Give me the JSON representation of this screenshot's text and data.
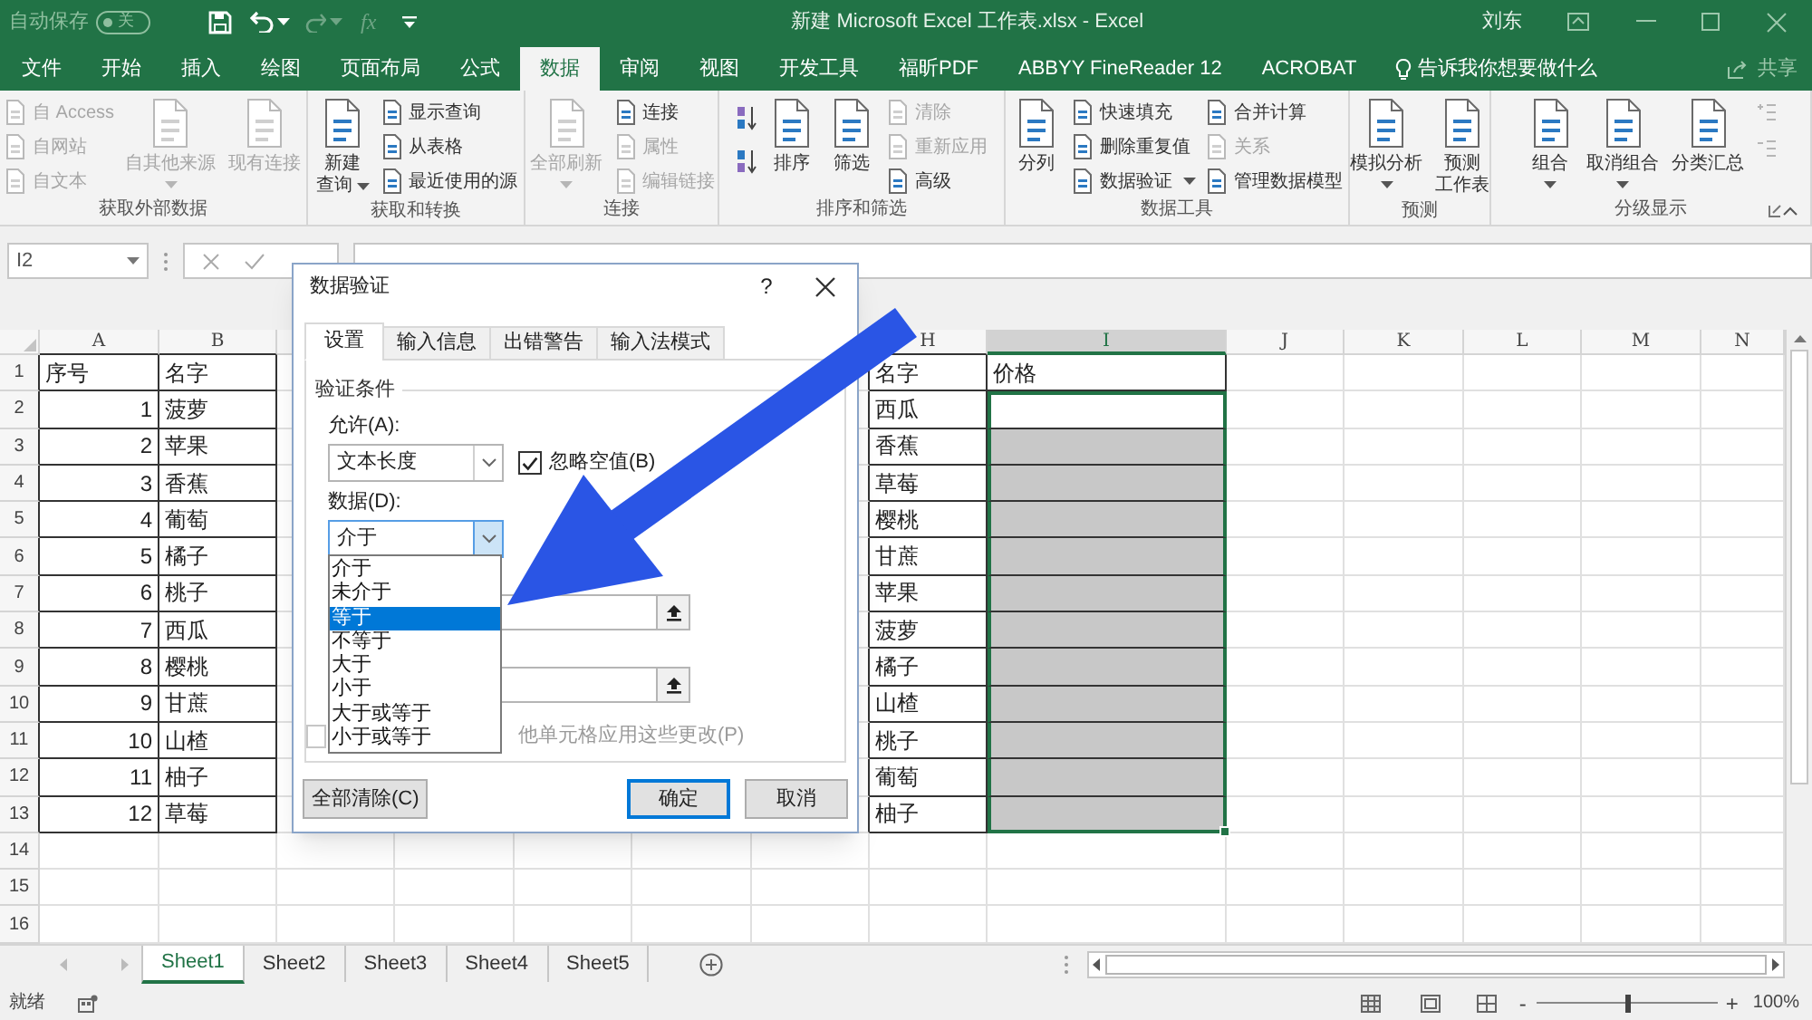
{
  "title_bar": {
    "autosave_label": "自动保存",
    "autosave_on": false,
    "autosave_state": "关",
    "function_symbol": "fx",
    "title": "新建 Microsoft Excel 工作表.xlsx - Excel",
    "user": "刘东"
  },
  "ribbon_tabs": [
    {
      "label": "文件",
      "selected": false
    },
    {
      "label": "开始",
      "selected": false
    },
    {
      "label": "插入",
      "selected": false
    },
    {
      "label": "绘图",
      "selected": false
    },
    {
      "label": "页面布局",
      "selected": false
    },
    {
      "label": "公式",
      "selected": false
    },
    {
      "label": "数据",
      "selected": true
    },
    {
      "label": "审阅",
      "selected": false
    },
    {
      "label": "视图",
      "selected": false
    },
    {
      "label": "开发工具",
      "selected": false
    },
    {
      "label": "福昕PDF",
      "selected": false
    },
    {
      "label": "ABBYY FineReader 12",
      "selected": false
    },
    {
      "label": "ACROBAT",
      "selected": false
    }
  ],
  "tell_me": "告诉我你想要做什么",
  "share": "共享",
  "ribbon": {
    "groups": [
      {
        "label": "获取外部数据",
        "launcher": false,
        "columns": [
          {
            "kind": "stack",
            "items": [
              {
                "label": "自 Access",
                "disabled": true,
                "menu": false
              },
              {
                "label": "自网站",
                "disabled": true,
                "menu": false
              },
              {
                "label": "自文本",
                "disabled": true,
                "menu": false
              }
            ]
          },
          {
            "kind": "large",
            "lines": [
              "自其他来源"
            ],
            "disabled": true,
            "menu": true
          },
          {
            "kind": "large",
            "lines": [
              "现有连接"
            ],
            "disabled": true,
            "menu": false
          }
        ]
      },
      {
        "label": "获取和转换",
        "launcher": false,
        "columns": [
          {
            "kind": "large",
            "lines": [
              "新建",
              "查询"
            ],
            "disabled": false,
            "menu": true
          },
          {
            "kind": "stack",
            "items": [
              {
                "label": "显示查询",
                "disabled": false,
                "menu": false
              },
              {
                "label": "从表格",
                "disabled": false,
                "menu": false
              },
              {
                "label": "最近使用的源",
                "disabled": false,
                "menu": false
              }
            ]
          }
        ]
      },
      {
        "label": "连接",
        "launcher": false,
        "columns": [
          {
            "kind": "large",
            "lines": [
              "全部刷新"
            ],
            "disabled": true,
            "menu": true
          },
          {
            "kind": "stack",
            "items": [
              {
                "label": "连接",
                "disabled": false,
                "menu": false
              },
              {
                "label": "属性",
                "disabled": true,
                "menu": false
              },
              {
                "label": "编辑链接",
                "disabled": true,
                "menu": false
              }
            ]
          }
        ]
      },
      {
        "label": "排序和筛选",
        "launcher": false,
        "columns": [
          {
            "kind": "sort"
          },
          {
            "kind": "large",
            "lines": [
              "排序"
            ],
            "disabled": false,
            "menu": false
          },
          {
            "kind": "large",
            "lines": [
              "筛选"
            ],
            "disabled": false,
            "menu": false
          },
          {
            "kind": "stack",
            "items": [
              {
                "label": "清除",
                "disabled": true,
                "menu": false
              },
              {
                "label": "重新应用",
                "disabled": true,
                "menu": false
              },
              {
                "label": "高级",
                "disabled": false,
                "menu": false
              }
            ]
          }
        ]
      },
      {
        "label": "数据工具",
        "launcher": false,
        "columns": [
          {
            "kind": "large",
            "lines": [
              "分列"
            ],
            "disabled": false,
            "menu": false
          },
          {
            "kind": "stack",
            "items": [
              {
                "label": "快速填充",
                "disabled": false,
                "menu": false
              },
              {
                "label": "删除重复值",
                "disabled": false,
                "menu": false
              },
              {
                "label": "数据验证",
                "disabled": false,
                "menu": true
              }
            ]
          },
          {
            "kind": "stack",
            "items": [
              {
                "label": "合并计算",
                "disabled": false,
                "menu": false
              },
              {
                "label": "关系",
                "disabled": true,
                "menu": false
              },
              {
                "label": "管理数据模型",
                "disabled": false,
                "menu": false
              }
            ]
          }
        ]
      },
      {
        "label": "预测",
        "launcher": false,
        "columns": [
          {
            "kind": "large",
            "lines": [
              "模拟分析"
            ],
            "disabled": false,
            "menu": true
          },
          {
            "kind": "large",
            "lines": [
              "预测",
              "工作表"
            ],
            "disabled": false,
            "menu": false
          }
        ]
      },
      {
        "label": "分级显示",
        "launcher": true,
        "columns": [
          {
            "kind": "large",
            "lines": [
              "组合"
            ],
            "disabled": false,
            "menu": true
          },
          {
            "kind": "large",
            "lines": [
              "取消组合"
            ],
            "disabled": false,
            "menu": true
          },
          {
            "kind": "large",
            "lines": [
              "分类汇总"
            ],
            "disabled": false,
            "menu": false
          },
          {
            "kind": "outline"
          }
        ]
      }
    ]
  },
  "sheet": {
    "name_box": "I2",
    "columns": [
      {
        "letter": "A",
        "selected": false
      },
      {
        "letter": "B",
        "selected": false
      },
      {
        "letter": "H",
        "selected": false
      },
      {
        "letter": "I",
        "selected": true
      },
      {
        "letter": "J",
        "selected": false
      },
      {
        "letter": "K",
        "selected": false
      },
      {
        "letter": "L",
        "selected": false
      },
      {
        "letter": "M",
        "selected": false
      },
      {
        "letter": "N",
        "selected": false
      }
    ],
    "rows": [
      {
        "number": "1",
        "A": "序号",
        "B": "名字",
        "H": "名字",
        "I": "价格",
        "I_shaded": false,
        "I_selected": false
      },
      {
        "number": "2",
        "A": "1",
        "B": "菠萝",
        "H": "西瓜",
        "I_shaded": false,
        "I_selected": true
      },
      {
        "number": "3",
        "A": "2",
        "B": "苹果",
        "H": "香蕉",
        "I_shaded": true,
        "I_selected": true
      },
      {
        "number": "4",
        "A": "3",
        "B": "香蕉",
        "H": "草莓",
        "I_shaded": true,
        "I_selected": true
      },
      {
        "number": "5",
        "A": "4",
        "B": "葡萄",
        "H": "樱桃",
        "I_shaded": true,
        "I_selected": true
      },
      {
        "number": "6",
        "A": "5",
        "B": "橘子",
        "H": "甘蔗",
        "I_shaded": true,
        "I_selected": true
      },
      {
        "number": "7",
        "A": "6",
        "B": "桃子",
        "H": "苹果",
        "I_shaded": true,
        "I_selected": true
      },
      {
        "number": "8",
        "A": "7",
        "B": "西瓜",
        "H": "菠萝",
        "I_shaded": true,
        "I_selected": true
      },
      {
        "number": "9",
        "A": "8",
        "B": "樱桃",
        "H": "橘子",
        "I_shaded": true,
        "I_selected": true
      },
      {
        "number": "10",
        "A": "9",
        "B": "甘蔗",
        "H": "山楂",
        "I_shaded": true,
        "I_selected": true
      },
      {
        "number": "11",
        "A": "10",
        "B": "山楂",
        "H": "桃子",
        "I_shaded": true,
        "I_selected": true
      },
      {
        "number": "12",
        "A": "11",
        "B": "柚子",
        "H": "葡萄",
        "I_shaded": true,
        "I_selected": true
      },
      {
        "number": "13",
        "A": "12",
        "B": "草莓",
        "H": "柚子",
        "I_shaded": true,
        "I_selected": true
      },
      {
        "number": "14"
      },
      {
        "number": "15"
      },
      {
        "number": "16"
      }
    ]
  },
  "sheet_tabs": [
    {
      "label": "Sheet1",
      "selected": true
    },
    {
      "label": "Sheet2",
      "selected": false
    },
    {
      "label": "Sheet3",
      "selected": false
    },
    {
      "label": "Sheet4",
      "selected": false
    },
    {
      "label": "Sheet5",
      "selected": false
    }
  ],
  "status_bar": {
    "ready": "就绪",
    "zoom_out": "-",
    "zoom_in": "+",
    "zoom": {
      "level": 0.5,
      "label": "100%"
    }
  },
  "dialog": {
    "title": "数据验证",
    "help": "?",
    "tabs": [
      {
        "label": "设置",
        "selected": true
      },
      {
        "label": "输入信息",
        "selected": false
      },
      {
        "label": "出错警告",
        "selected": false
      },
      {
        "label": "输入法模式",
        "selected": false
      }
    ],
    "section": "验证条件",
    "allow_label": "允许(A):",
    "allow_value": "文本长度",
    "ignore_blank": {
      "label": "忽略空值(B)",
      "checked": true
    },
    "data_label": "数据(D):",
    "data_value": "介于",
    "data_open": true,
    "data_options": [
      {
        "label": "介于",
        "selected": false
      },
      {
        "label": "未介于",
        "selected": false
      },
      {
        "label": "等于",
        "selected": true
      },
      {
        "label": "不等于",
        "selected": false
      },
      {
        "label": "大于",
        "selected": false
      },
      {
        "label": "小于",
        "selected": false
      },
      {
        "label": "大于或等于",
        "selected": false
      },
      {
        "label": "小于或等于",
        "selected": false
      }
    ],
    "apply_all": {
      "label": "他单元格应用这些更改(P)",
      "checked": false
    },
    "buttons": [
      {
        "label": "全部清除(C)",
        "default": false
      },
      {
        "label": "确定",
        "default": true
      },
      {
        "label": "取消",
        "default": false
      }
    ]
  }
}
